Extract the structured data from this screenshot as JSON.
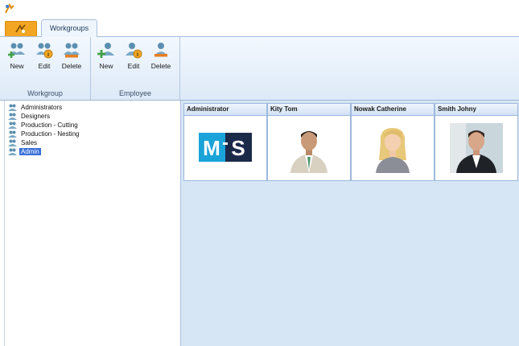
{
  "ribbon": {
    "tab_label": "Workgroups",
    "groups": [
      {
        "label": "Workgroup",
        "buttons": [
          {
            "label": "New",
            "icon": "group-add-icon"
          },
          {
            "label": "Edit",
            "icon": "group-edit-icon"
          },
          {
            "label": "Delete",
            "icon": "group-delete-icon"
          }
        ]
      },
      {
        "label": "Employee",
        "buttons": [
          {
            "label": "New",
            "icon": "user-add-icon"
          },
          {
            "label": "Edit",
            "icon": "user-edit-icon"
          },
          {
            "label": "Delete",
            "icon": "user-delete-icon"
          }
        ]
      }
    ]
  },
  "tree": {
    "items": [
      {
        "label": "Administrators",
        "selected": false
      },
      {
        "label": "Designers",
        "selected": false
      },
      {
        "label": "Production - Cutting",
        "selected": false
      },
      {
        "label": "Production - Nesting",
        "selected": false
      },
      {
        "label": "Sales",
        "selected": false
      },
      {
        "label": "Admin",
        "selected": true
      }
    ]
  },
  "employees": [
    {
      "name": "Administrator",
      "logo_text": "MS",
      "logo_letters": [
        "M",
        "S"
      ]
    },
    {
      "name": "Kity Tom"
    },
    {
      "name": "Nowak Catherine"
    },
    {
      "name": "Smith Johny"
    }
  ],
  "colors": {
    "accent": "#f2a623",
    "selection": "#3a6fd8",
    "logo_blue": "#1aa3d9",
    "logo_navy": "#1c2a4a"
  }
}
